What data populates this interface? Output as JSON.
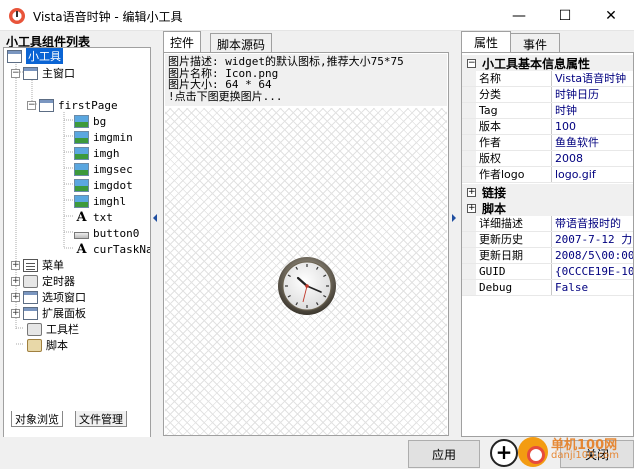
{
  "window": {
    "title": "Vista语音时钟 - 编辑小工具",
    "min_glyph": "—",
    "max_glyph": "☐",
    "close_glyph": "✕"
  },
  "left_panel": {
    "heading": "小工具组件列表",
    "tree": [
      {
        "label": "小工具",
        "icon": "gadget-icon",
        "selected": true
      },
      {
        "label": "主窗口",
        "icon": "window-icon"
      },
      {
        "label": "firstPage",
        "icon": "page-icon"
      },
      {
        "label": "bg",
        "icon": "image-icon"
      },
      {
        "label": "imgmin",
        "icon": "image-icon"
      },
      {
        "label": "imgh",
        "icon": "image-icon"
      },
      {
        "label": "imgsec",
        "icon": "image-icon"
      },
      {
        "label": "imgdot",
        "icon": "image-icon"
      },
      {
        "label": "imghl",
        "icon": "image-icon"
      },
      {
        "label": "txt",
        "icon": "text-icon"
      },
      {
        "label": "button0",
        "icon": "button-icon"
      },
      {
        "label": "curTaskNam",
        "icon": "text-icon"
      },
      {
        "label": "菜单",
        "icon": "menu-icon"
      },
      {
        "label": "定时器",
        "icon": "timer-icon"
      },
      {
        "label": "选项窗口",
        "icon": "window-icon"
      },
      {
        "label": "扩展面板",
        "icon": "panel-icon"
      },
      {
        "label": "工具栏",
        "icon": "toolbar-icon"
      },
      {
        "label": "脚本",
        "icon": "script-icon"
      }
    ],
    "tabs": [
      "对象浏览",
      "文件管理"
    ]
  },
  "center": {
    "tabs": [
      "控件",
      "脚本源码"
    ],
    "info_lines": [
      "图片描述: widget的默认图标,推荐大小75*75",
      "图片名称: Icon.png",
      "图片大小: 64 * 64",
      "!点击下图更换图片..."
    ]
  },
  "right": {
    "tabs": [
      "属性",
      "事件"
    ],
    "category_basic": "小工具基本信息属性",
    "properties": [
      {
        "name": "名称",
        "value": "Vista语音时钟"
      },
      {
        "name": "分类",
        "value": "时钟日历"
      },
      {
        "name": "Tag",
        "value": "时钟"
      },
      {
        "name": "版本",
        "value": "100"
      },
      {
        "name": "作者",
        "value": "鱼鱼软件"
      },
      {
        "name": "版权",
        "value": "2008"
      },
      {
        "name": "作者logo",
        "value": "logo.gif"
      }
    ],
    "category_link": "链接",
    "category_script": "脚本",
    "script_properties": [
      {
        "name": "详细描述",
        "value": "带语音报时的"
      },
      {
        "name": "更新历史",
        "value": "2007-7-12  力"
      },
      {
        "name": "更新日期",
        "value": "2008/5\\00:00:"
      },
      {
        "name": "GUID",
        "value": "{0CCCE19E-10"
      },
      {
        "name": "Debug",
        "value": "False"
      }
    ]
  },
  "bottom": {
    "apply_label": "应用",
    "close_label": "关闭"
  },
  "watermark": {
    "line1": "单机100网",
    "line2": "danji100.com"
  }
}
